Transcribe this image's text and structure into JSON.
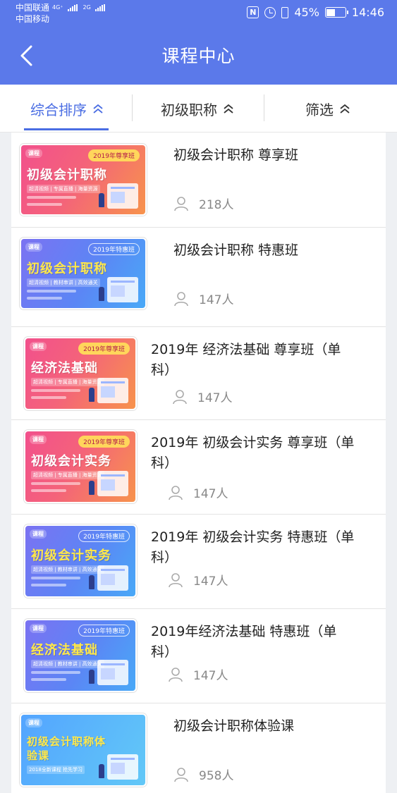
{
  "status_bar": {
    "carrier1": "中国联通",
    "carrier1_net": "4G⁺",
    "carrier2": "中国移动",
    "carrier2_net": "2G",
    "nfc": "N",
    "battery": "45%",
    "battery_level": 0.45,
    "time": "14:46"
  },
  "header": {
    "title": "课程中心"
  },
  "tabs": [
    {
      "label": "综合排序",
      "active": true
    },
    {
      "label": "初级职称",
      "active": false
    },
    {
      "label": "筛选",
      "active": false
    }
  ],
  "courses": [
    {
      "title": "初级会计职称 尊享班",
      "students": "218人",
      "thumb": {
        "style": "warm",
        "tag": "2019年尊享班",
        "main": "初级会计职称",
        "sub": "超清视频 | 专属直播 | 海量资源"
      }
    },
    {
      "title": "初级会计职称 特惠班",
      "students": "147人",
      "thumb": {
        "style": "cool",
        "tag": "2019年特惠班",
        "main": "初级会计职称",
        "sub": "超清视频 | 教材串讲 | 高效通关"
      }
    },
    {
      "title": "2019年 经济法基础 尊享班（单科）",
      "students": "147人",
      "thumb": {
        "style": "warm",
        "tag": "2019年尊享班",
        "main": "经济法基础",
        "sub": "超清视频 | 专属直播 | 海量资源"
      }
    },
    {
      "title": "2019年 初级会计实务 尊享班（单科）",
      "students": "147人",
      "thumb": {
        "style": "warm",
        "tag": "2019年尊享班",
        "main": "初级会计实务",
        "sub": "超清视频 | 专属直播 | 海量资源"
      }
    },
    {
      "title": "2019年 初级会计实务 特惠班（单科）",
      "students": "147人",
      "thumb": {
        "style": "cool",
        "tag": "2019年特惠班",
        "main": "初级会计实务",
        "sub": "超清视频 | 教材串讲 | 高效通关"
      }
    },
    {
      "title": "2019年经济法基础 特惠班（单科）",
      "students": "147人",
      "thumb": {
        "style": "cool",
        "tag": "2019年特惠班",
        "main": "经济法基础",
        "sub": "超清视频 | 教材串讲 | 高效通关"
      }
    },
    {
      "title": "初级会计职称体验课",
      "students": "958人",
      "thumb": {
        "style": "sky",
        "tag": "",
        "main": "初级会计职称体验课",
        "sub": "2018全新课程 抢先学习"
      }
    }
  ],
  "colors": {
    "primary": "#5b79ea",
    "active_tab": "#4a6de3",
    "text": "#222222",
    "muted": "#888888"
  }
}
